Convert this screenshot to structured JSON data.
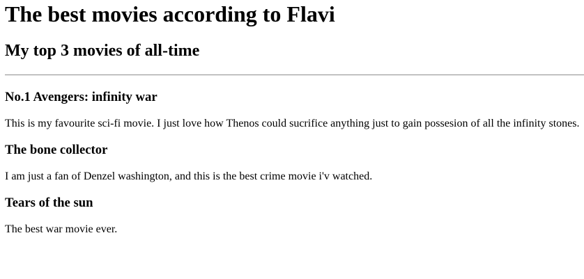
{
  "page": {
    "title": "The best movies according to Flavi",
    "subtitle": "My top 3 movies of all-time"
  },
  "movies": [
    {
      "heading": "No.1 Avengers: infinity war",
      "description": "This is my favourite sci-fi movie. I just love how Thenos could sucrifice anything just to gain possesion of all the infinity stones."
    },
    {
      "heading": "The bone collector",
      "description": "I am just a fan of Denzel washington, and this is the best crime movie i'v watched."
    },
    {
      "heading": "Tears of the sun",
      "description": "The best war movie ever."
    }
  ]
}
